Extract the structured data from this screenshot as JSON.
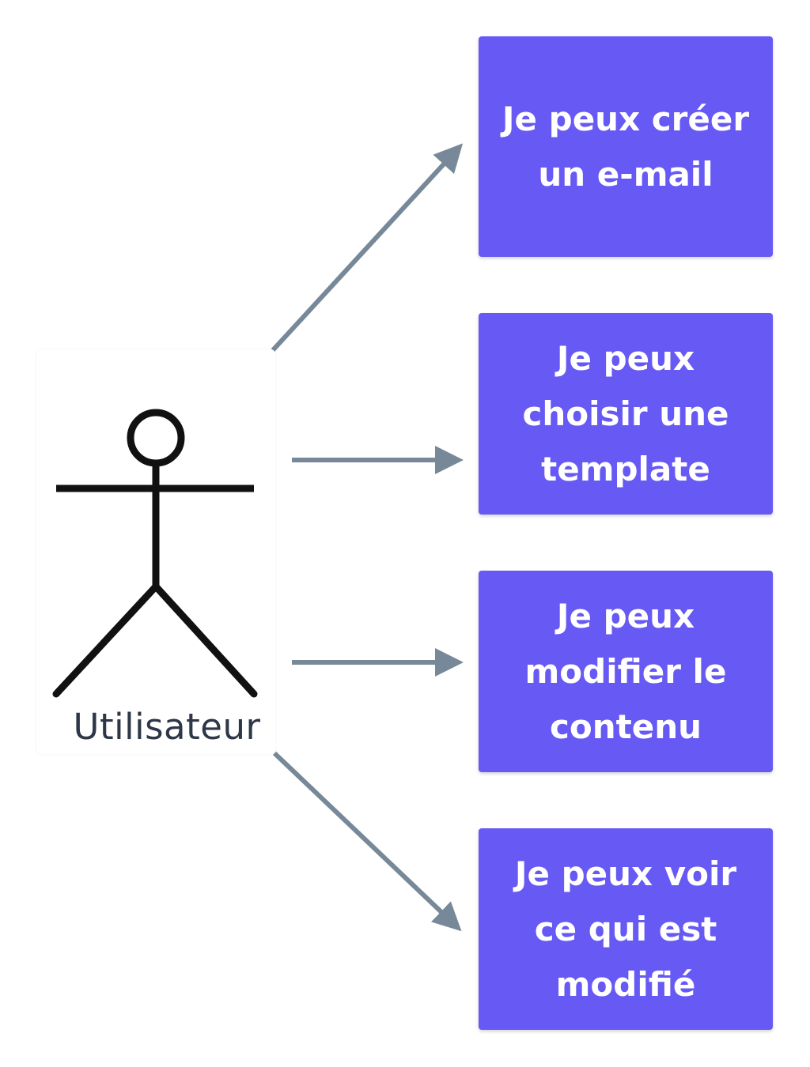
{
  "actor": {
    "label": "Utilisateur",
    "icon": "stick-figure-icon"
  },
  "use_cases": [
    {
      "label": "Je peux créer\nun e-mail"
    },
    {
      "label": "Je peux\nchoisir une\ntemplate"
    },
    {
      "label": "Je peux\nmodifier le\ncontenu"
    },
    {
      "label": "Je peux voir\nce qui est\nmodifié"
    }
  ],
  "colors": {
    "box_fill": "#6759f3",
    "box_text": "#ffffff",
    "arrow": "#778899",
    "actor_text": "#2d3748",
    "figure": "#111111"
  }
}
